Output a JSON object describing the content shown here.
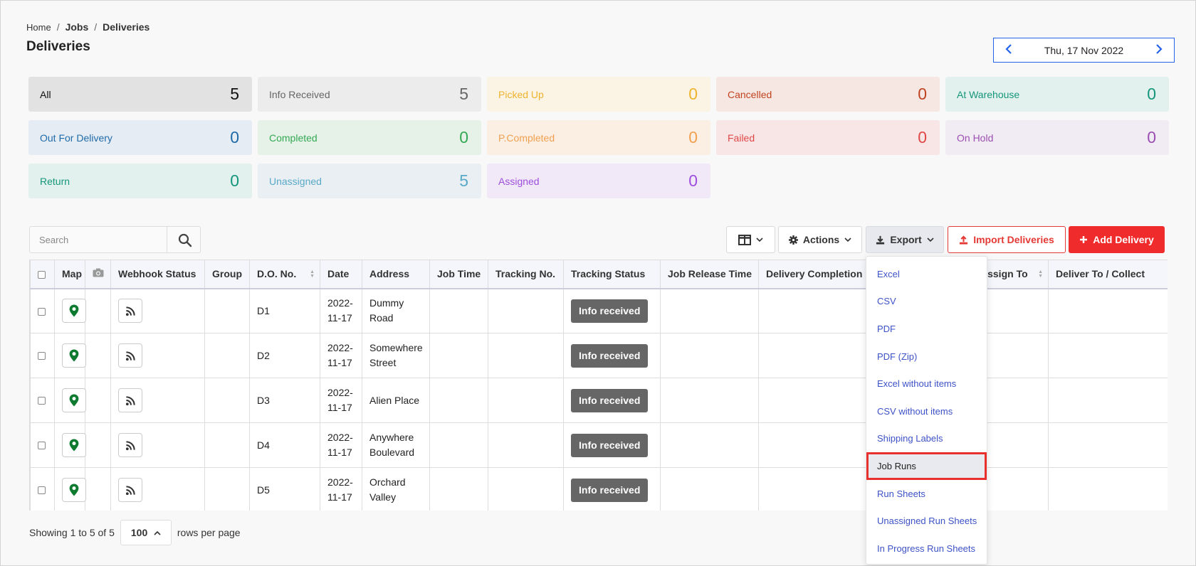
{
  "breadcrumb": {
    "home": "Home",
    "jobs": "Jobs",
    "current": "Deliveries"
  },
  "page_title": "Deliveries",
  "date_nav": {
    "date": "Thu, 17 Nov 2022"
  },
  "stats": [
    {
      "label": "All",
      "count": "5",
      "bg": "#e2e2e2",
      "fg": "#111111"
    },
    {
      "label": "Info Received",
      "count": "5",
      "bg": "#ececec",
      "fg": "#666666"
    },
    {
      "label": "Picked Up",
      "count": "0",
      "bg": "#fbf3e3",
      "fg": "#efb32d"
    },
    {
      "label": "Cancelled",
      "count": "0",
      "bg": "#f6e7e3",
      "fg": "#c0431f"
    },
    {
      "label": "At Warehouse",
      "count": "0",
      "bg": "#e3f1ee",
      "fg": "#14967a"
    },
    {
      "label": "Out For Delivery",
      "count": "0",
      "bg": "#e6ecf4",
      "fg": "#1f6aa8"
    },
    {
      "label": "Completed",
      "count": "0",
      "bg": "#e6f2e8",
      "fg": "#34a853"
    },
    {
      "label": "P.Completed",
      "count": "0",
      "bg": "#fbefe4",
      "fg": "#f1a04f"
    },
    {
      "label": "Failed",
      "count": "0",
      "bg": "#f8e6e6",
      "fg": "#e04848"
    },
    {
      "label": "On Hold",
      "count": "0",
      "bg": "#f1ebf4",
      "fg": "#9b4fb1"
    },
    {
      "label": "Return",
      "count": "0",
      "bg": "#e3f1ee",
      "fg": "#14967a"
    },
    {
      "label": "Unassigned",
      "count": "5",
      "bg": "#e9eff2",
      "fg": "#59a9c9"
    },
    {
      "label": "Assigned",
      "count": "0",
      "bg": "#f1e9f8",
      "fg": "#9d4edd"
    }
  ],
  "toolbar": {
    "search_placeholder": "Search",
    "actions_label": "Actions",
    "export_label": "Export",
    "import_label": "Import Deliveries",
    "add_label": "Add Delivery"
  },
  "table": {
    "columns": [
      "Map",
      "",
      "Webhook Status",
      "Group",
      "D.O. No.",
      "Date",
      "Address",
      "Job Time",
      "Tracking No.",
      "Tracking Status",
      "Job Release Time",
      "Delivery Completion",
      "",
      "Assign To",
      "Deliver To / Collect"
    ],
    "rows": [
      {
        "do_no": "D1",
        "date": "2022-11-17",
        "address": "Dummy Road",
        "status": "Info received"
      },
      {
        "do_no": "D2",
        "date": "2022-11-17",
        "address": "Somewhere Street",
        "status": "Info received"
      },
      {
        "do_no": "D3",
        "date": "2022-11-17",
        "address": "Alien Place",
        "status": "Info received"
      },
      {
        "do_no": "D4",
        "date": "2022-11-17",
        "address": "Anywhere Boulevard",
        "status": "Info received"
      },
      {
        "do_no": "D5",
        "date": "2022-11-17",
        "address": "Orchard Valley",
        "status": "Info received"
      }
    ]
  },
  "footer": {
    "showing": "Showing 1 to 5 of 5",
    "rows_value": "100",
    "rows_suffix": "rows per page"
  },
  "export_menu": {
    "items": [
      "Excel",
      "CSV",
      "PDF",
      "PDF (Zip)",
      "Excel without items",
      "CSV without items",
      "Shipping Labels",
      "Job Runs",
      "Run Sheets",
      "Unassigned Run Sheets",
      "In Progress Run Sheets"
    ],
    "selected": "Job Runs"
  },
  "icons": {
    "map_pin": "map-pin-icon",
    "webhook": "rss-feed-icon",
    "camera": "camera-icon",
    "search": "search-icon"
  }
}
